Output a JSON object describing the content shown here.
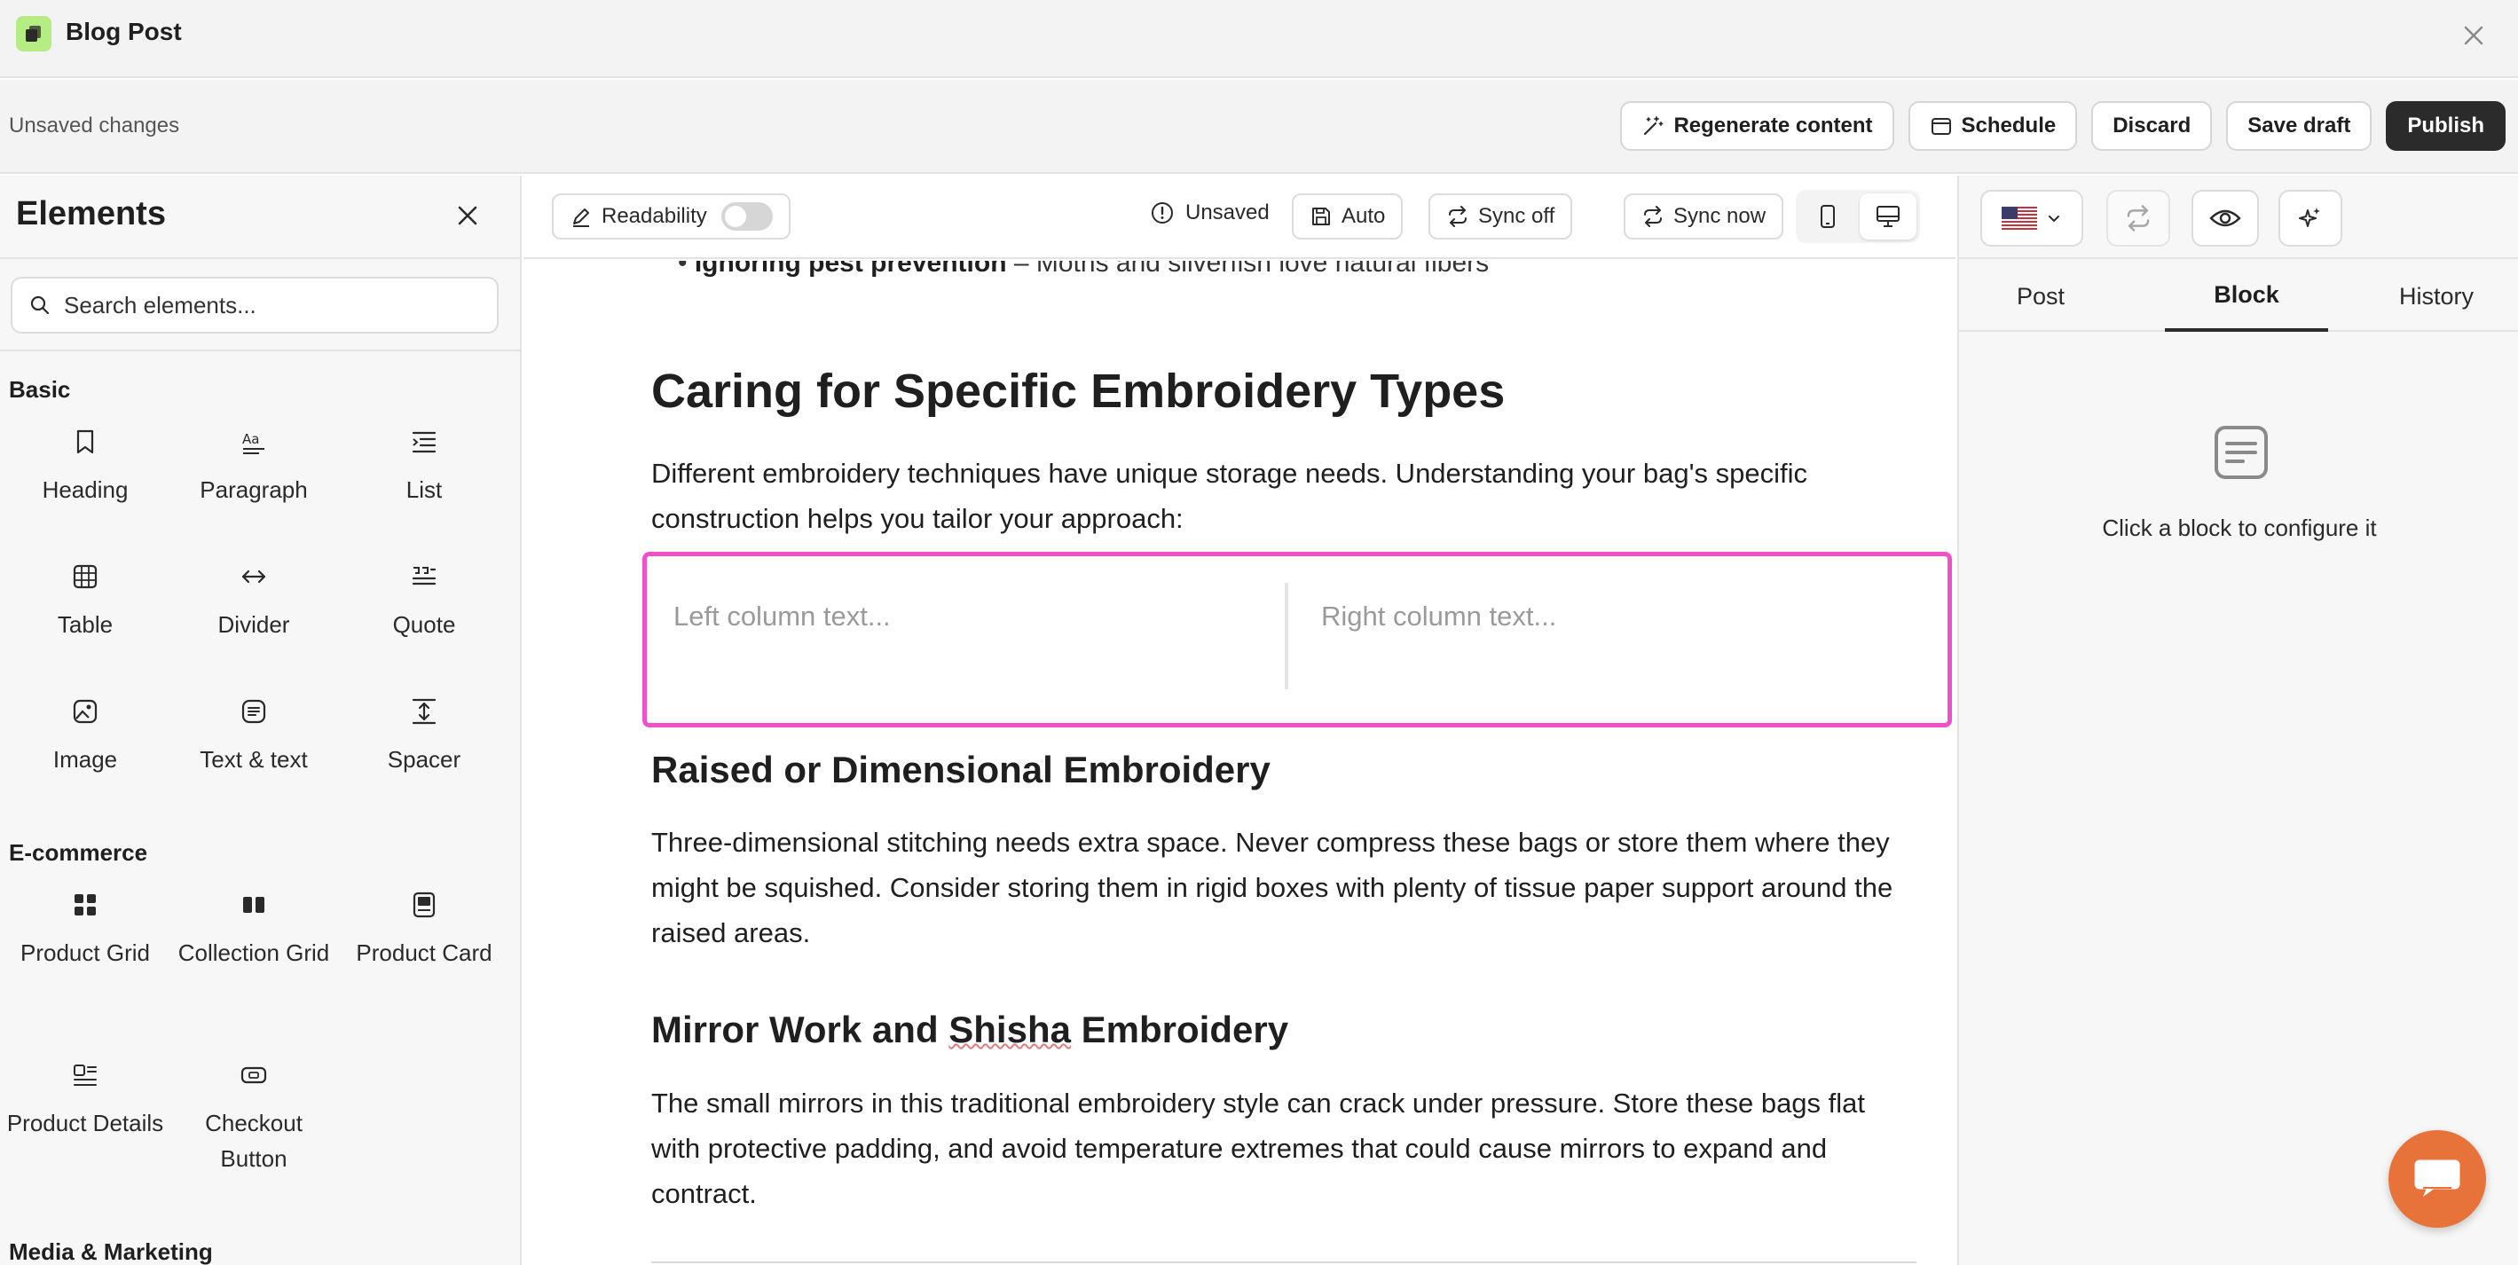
{
  "window": {
    "title": "Blog Post"
  },
  "actionbar": {
    "status": "Unsaved changes",
    "regenerate": "Regenerate content",
    "schedule": "Schedule",
    "discard": "Discard",
    "save_draft": "Save draft",
    "publish": "Publish"
  },
  "sidebar": {
    "title": "Elements",
    "search_placeholder": "Search elements...",
    "sections": {
      "basic": "Basic",
      "ecommerce": "E-commerce",
      "media": "Media & Marketing"
    },
    "basic_items": [
      "Heading",
      "Paragraph",
      "List",
      "Table",
      "Divider",
      "Quote",
      "Image",
      "Text & text",
      "Spacer"
    ],
    "ecommerce_items": [
      "Product Grid",
      "Collection Grid",
      "Product Card",
      "Product Details",
      "Checkout Button"
    ]
  },
  "toolbar": {
    "readability": "Readability",
    "unsaved": "Unsaved",
    "auto": "Auto",
    "sync_off": "Sync off",
    "sync_now": "Sync now"
  },
  "content": {
    "bullet_bold": "Ignoring pest prevention",
    "bullet_rest": " – Moths and silverfish love natural fibers",
    "h2": "Caring for Specific Embroidery Types",
    "intro": "Different embroidery techniques have unique storage needs. Understanding your bag's specific construction helps you tailor your approach:",
    "left_placeholder": "Left column text...",
    "right_placeholder": "Right column text...",
    "h3_raised": "Raised or Dimensional Embroidery",
    "p_raised": "Three-dimensional stitching needs extra space. Never compress these bags or store them where they might be squished. Consider storing them in rigid boxes with plenty of tissue paper support around the raised areas.",
    "h3_mirror_pre": "Mirror Work and ",
    "h3_mirror_word": "Shisha",
    "h3_mirror_post": " Embroidery",
    "p_mirror": "The small mirrors in this traditional embroidery style can crack under pressure. Store these bags flat with protective padding, and avoid temperature extremes that could cause mirrors to expand and contract."
  },
  "rpanel": {
    "tabs": [
      "Post",
      "Block",
      "History"
    ],
    "active_tab": "Block",
    "empty_text": "Click a block to configure it"
  },
  "colors": {
    "accent": "#f250c8",
    "primary": "#2b2b2b",
    "brand": "#b6ec84",
    "chat": "#e8733a"
  },
  "icons": [
    "app-logo-icon",
    "close-icon",
    "magic-wand-icon",
    "calendar-icon",
    "search-icon",
    "flag-us-icon",
    "sync-icon",
    "eye-icon",
    "sparkle-icon",
    "chat-icon"
  ]
}
